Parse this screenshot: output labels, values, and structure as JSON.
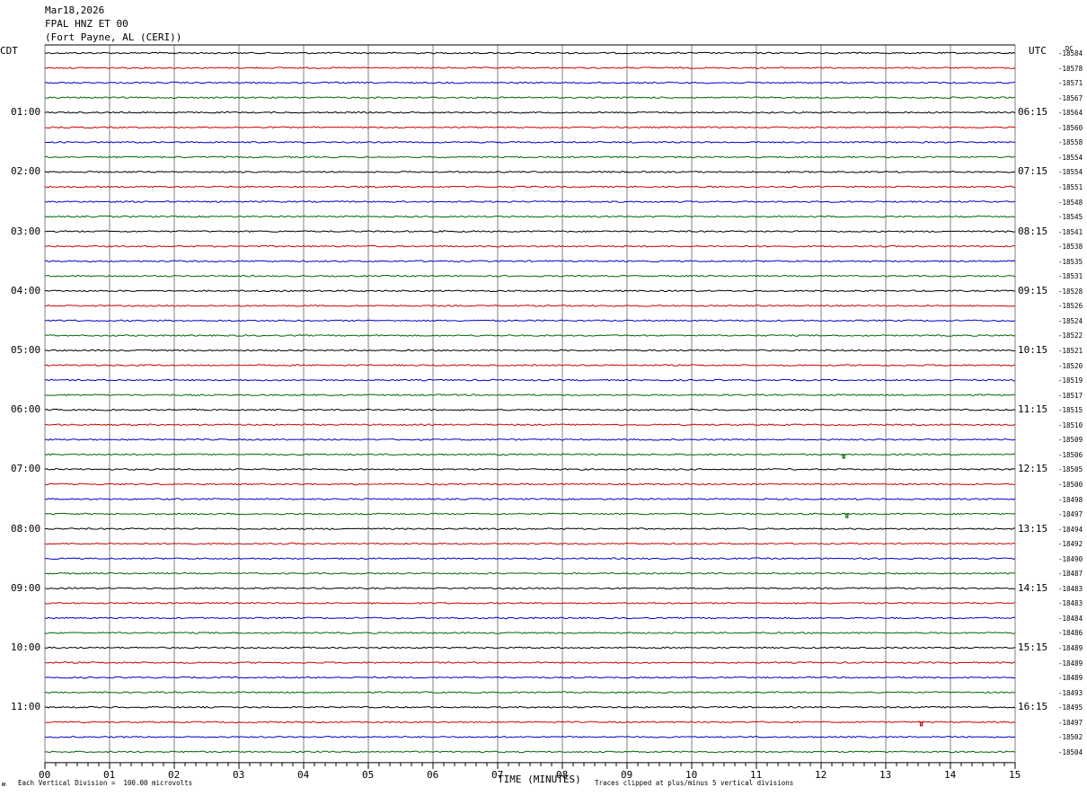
{
  "header": {
    "date": "Mar18,2026",
    "station": "FPAL HNZ ET 00",
    "location": "(Fort Payne, AL (CERI))"
  },
  "left_axis_title": "CDT",
  "right_axis_title": "UTC",
  "dc_title": "DC",
  "footer": {
    "mark": "ᴍ",
    "scale": "Each Vertical Division =  100.00 microvolts",
    "clip": "Traces clipped at plus/minus 5 vertical divisions"
  },
  "colors": {
    "trace_cycle": [
      "#000000",
      "#cc0000",
      "#0000cc",
      "#006600"
    ],
    "grid": "#808080"
  },
  "chart_data": {
    "type": "line",
    "description_type": "helicorder",
    "xlabel": "TIME (MINUTES)",
    "xlim": [
      0,
      15
    ],
    "x_ticks": [
      "00",
      "01",
      "02",
      "03",
      "04",
      "05",
      "06",
      "07",
      "08",
      "09",
      "10",
      "11",
      "12",
      "13",
      "14",
      "15"
    ],
    "left_hour_labels": [
      "01:00",
      "02:00",
      "03:00",
      "04:00",
      "05:00",
      "06:00",
      "07:00",
      "08:00",
      "09:00",
      "10:00",
      "11:00"
    ],
    "right_hour_labels": [
      "06:15",
      "07:15",
      "08:15",
      "09:15",
      "10:15",
      "11:15",
      "12:15",
      "13:15",
      "14:15",
      "15:15",
      "16:15"
    ],
    "dc_offsets": [
      "-18584",
      "-18578",
      "-18571",
      "-18567",
      "-18564",
      "-18560",
      "-18558",
      "-18554",
      "-18554",
      "-18551",
      "-18548",
      "-18545",
      "-18541",
      "-18538",
      "-18535",
      "-18531",
      "-18528",
      "-18526",
      "-18524",
      "-18522",
      "-18521",
      "-18520",
      "-18519",
      "-18517",
      "-18515",
      "-18510",
      "-18509",
      "-18506",
      "-18505",
      "-18500",
      "-18498",
      "-18497",
      "-18494",
      "-18492",
      "-18490",
      "-18487",
      "-18483",
      "-18483",
      "-18484",
      "-18486",
      "-18489",
      "-18489",
      "-18489",
      "-18493",
      "-18495",
      "-18497",
      "-18502",
      "-18504"
    ],
    "trace_count": 48,
    "minutes_per_trace": 15,
    "events": [
      {
        "trace": 27,
        "minute": 12.35,
        "note": "small green spike"
      },
      {
        "trace": 31,
        "minute": 12.4,
        "note": "small green spike"
      },
      {
        "trace": 45,
        "minute": 13.55,
        "note": "red spike"
      }
    ]
  }
}
